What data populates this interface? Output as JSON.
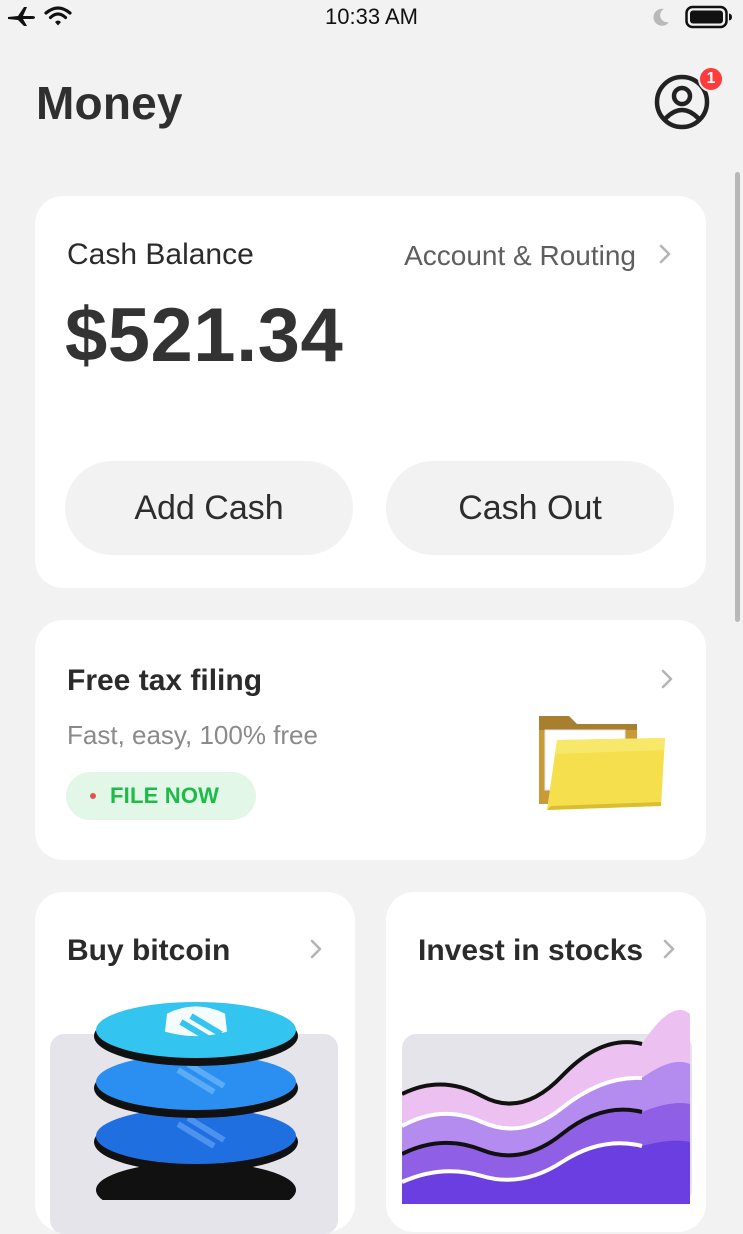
{
  "status_bar": {
    "time": "10:33 AM",
    "left_icons": [
      "airplane-icon",
      "wifi-icon"
    ],
    "right_icons": [
      "moon-icon",
      "battery-icon"
    ]
  },
  "header": {
    "title": "Money",
    "profile_badge": "1"
  },
  "balance_card": {
    "label": "Cash Balance",
    "routing_link": "Account & Routing",
    "amount": "$521.34",
    "add_cash_label": "Add Cash",
    "cash_out_label": "Cash Out"
  },
  "tax_card": {
    "title": "Free tax filing",
    "subtitle": "Fast, easy, 100% free",
    "cta_label": "FILE NOW"
  },
  "tiles": [
    {
      "title": "Buy bitcoin",
      "art": "bitcoin-coin-stack"
    },
    {
      "title": "Invest in stocks",
      "art": "stock-waves"
    }
  ],
  "colors": {
    "background": "#f2f2f3",
    "card": "#ffffff",
    "badge": "#ff3b3b",
    "cta_bg": "#e2f7e8",
    "cta_text": "#1dbb48",
    "bitcoin_blue": "#25b7ea",
    "stocks_purple": "#8f5fe6"
  }
}
